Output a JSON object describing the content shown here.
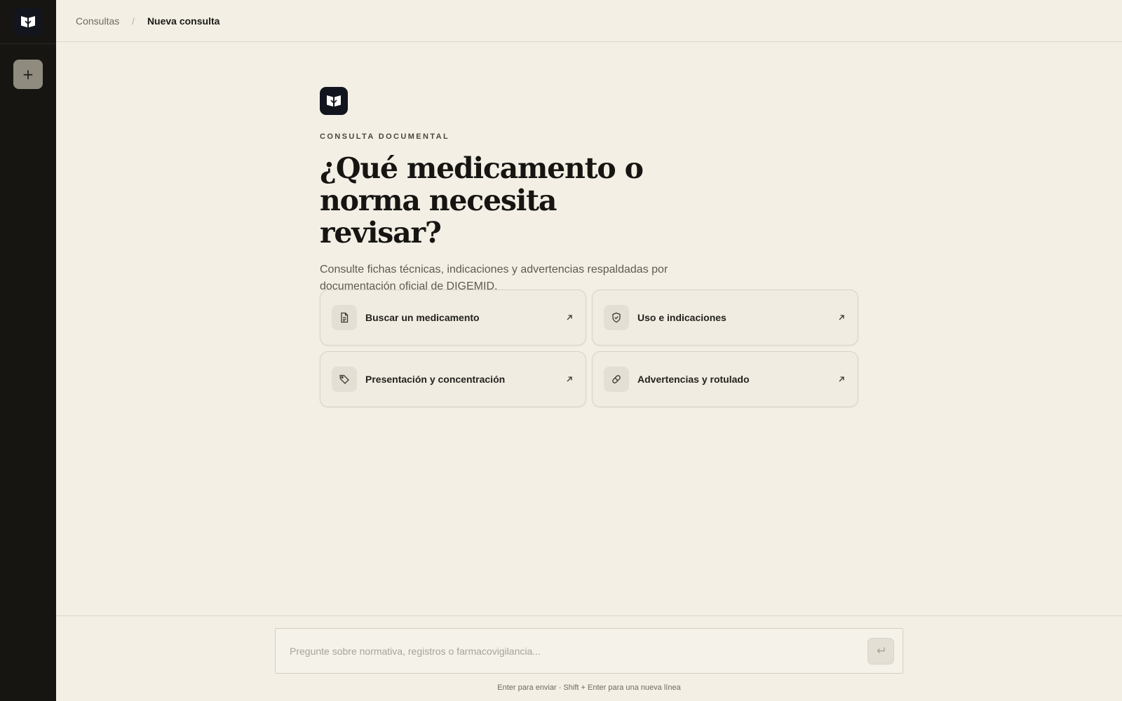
{
  "sidebar": {
    "logo_icon": "open-book-icon",
    "new_button_icon": "plus-icon",
    "new_button_glyph": "+"
  },
  "breadcrumb": {
    "parent": "Consultas",
    "separator": "/",
    "current": "Nueva consulta"
  },
  "hero": {
    "logo_icon": "open-book-icon",
    "eyebrow": "CONSULTA DOCUMENTAL",
    "title": "¿Qué medicamento o norma necesita revisar?",
    "subtitle": "Consulte fichas técnicas, indicaciones y advertencias respaldadas por documentación oficial de DIGEMID."
  },
  "suggestions": [
    {
      "label": "Buscar un medicamento",
      "icon": "document-icon"
    },
    {
      "label": "Uso e indicaciones",
      "icon": "shield-check-icon"
    },
    {
      "label": "Presentación y concentración",
      "icon": "tag-icon"
    },
    {
      "label": "Advertencias y rotulado",
      "icon": "pill-icon"
    }
  ],
  "composer": {
    "placeholder": "Pregunte sobre normativa, registros o farmacovigilancia...",
    "value": "",
    "send_icon": "enter-icon",
    "hint": "Enter para enviar · Shift + Enter para una nueva línea"
  },
  "colors": {
    "sidebar_bg": "#161512",
    "page_bg": "#f3efe5",
    "logo_bg": "#12151e",
    "new_button_bg": "#8f8b7f"
  }
}
